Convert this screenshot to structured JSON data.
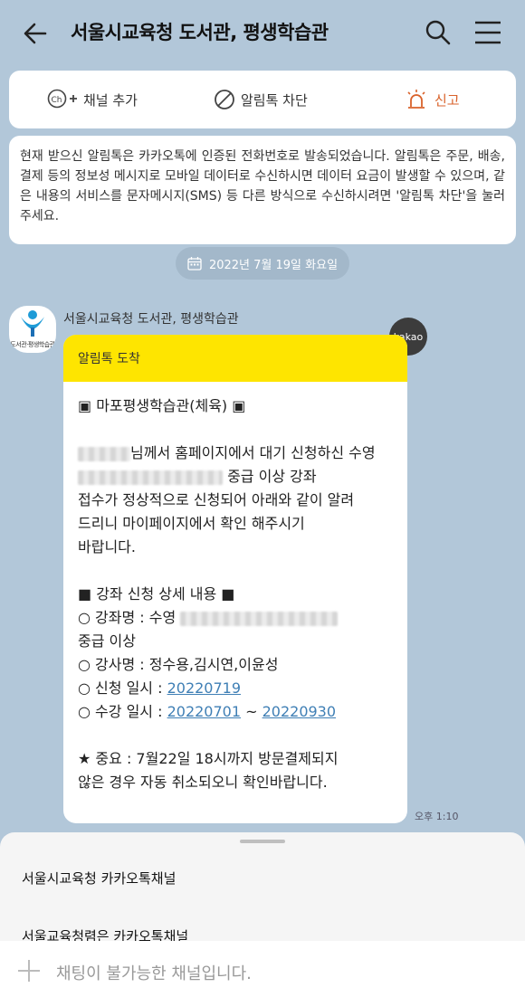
{
  "header": {
    "title": "서울시교육청 도서관, 평생학습관"
  },
  "actions": {
    "add_channel": "채널 추가",
    "block_alimtalk": "알림톡 차단",
    "report": "신고",
    "report_color": "#d9622b"
  },
  "notice": {
    "text": "현재 받으신 알림톡은 카카오톡에 인증된 전화번호로 발송되었습니다. 알림톡은 주문, 배송, 결제 등의 정보성 메시지로 모바일 데이터로 수신하시면 데이터 요금이 발생할 수 있으며, 같은 내용의 서비스를 문자메시지(SMS) 등 다른 방식으로 수신하시려면 '알림톡 차단'을 눌러주세요."
  },
  "date_divider": "2022년 7월 19일 화요일",
  "message": {
    "avatar_caption": "도서관·평생학습관",
    "sender": "서울시교육청 도서관, 평생학습관",
    "badge": "kakao",
    "head": "알림톡 도착",
    "line_title": "▣ 마포평생학습관(체육) ▣",
    "line_1": "님께서 홈페이지에서 대기 신청하신 수영",
    "line_2": " 중급 이상 강좌",
    "line_3": "접수가 정상적으로 신청되어 아래와 같이 알려",
    "line_4": "드리니 마이페이지에서 확인 해주시기",
    "line_5": "바랍니다.",
    "detail_title": "■ 강좌 신청 상세 내용 ■",
    "course_label": "○ 강좌명 : 수영",
    "course_cont": "중급 이상",
    "teacher": "○ 강사명 : 정수용,김시연,이윤성",
    "apply_label": "○ 신청 일시 : ",
    "apply_date": "20220719",
    "period_label": "○ 수강 일시 : ",
    "period_start": "20220701",
    "period_sep": " ~ ",
    "period_end": "20220930",
    "important_1": "★ 중요 : 7월22일 18시까지 방문결제되지",
    "important_2": "않은 경우 자동 취소되오니 확인바랍니다.",
    "time": "오후 1:10",
    "head_color": "#fee500",
    "link_color": "#3f7fb5"
  },
  "sheet": {
    "item_1": "서울시교육청 카카오톡채널",
    "item_2": "서울교육청렴은 카카오톡채널"
  },
  "footer": {
    "text": "채팅이 불가능한 채널입니다."
  }
}
